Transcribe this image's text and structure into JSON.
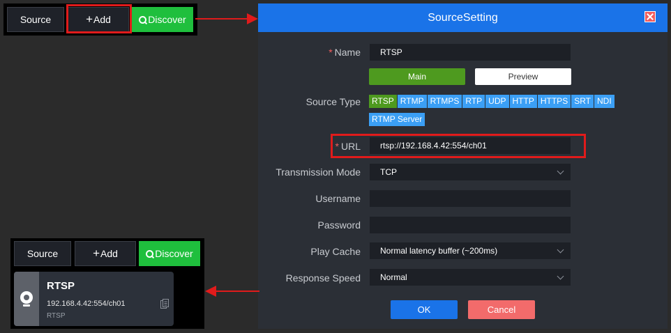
{
  "toolbar": {
    "source_label": "Source",
    "add_label": "Add",
    "discover_label": "Discover"
  },
  "source_list": {
    "items": [
      {
        "name": "RTSP",
        "url": "192.168.4.42:554/ch01",
        "type": "RTSP"
      }
    ]
  },
  "dialog": {
    "title": "SourceSetting",
    "name": {
      "label": "Name",
      "value": "RTSP"
    },
    "stream_tabs": {
      "main": "Main",
      "preview": "Preview"
    },
    "source_type": {
      "label": "Source Type",
      "options": [
        "RTSP",
        "RTMP",
        "RTMPS",
        "RTP",
        "UDP",
        "HTTP",
        "HTTPS",
        "SRT",
        "NDI",
        "RTMP Server"
      ],
      "selected": "RTSP"
    },
    "url": {
      "label": "URL",
      "value": "rtsp://192.168.4.42:554/ch01"
    },
    "transmission_mode": {
      "label": "Transmission Mode",
      "value": "TCP"
    },
    "username": {
      "label": "Username",
      "value": ""
    },
    "password": {
      "label": "Password",
      "value": ""
    },
    "play_cache": {
      "label": "Play Cache",
      "value": "Normal latency buffer (~200ms)"
    },
    "response_speed": {
      "label": "Response Speed",
      "value": "Normal"
    },
    "ok_label": "OK",
    "cancel_label": "Cancel"
  },
  "colors": {
    "accent_blue": "#1a73e8",
    "discover_green": "#1fbf3d",
    "selected_green": "#4e9a1f",
    "type_blue": "#3b9ff5",
    "highlight_red": "#e11b1b",
    "cancel_red": "#f26b6b"
  }
}
